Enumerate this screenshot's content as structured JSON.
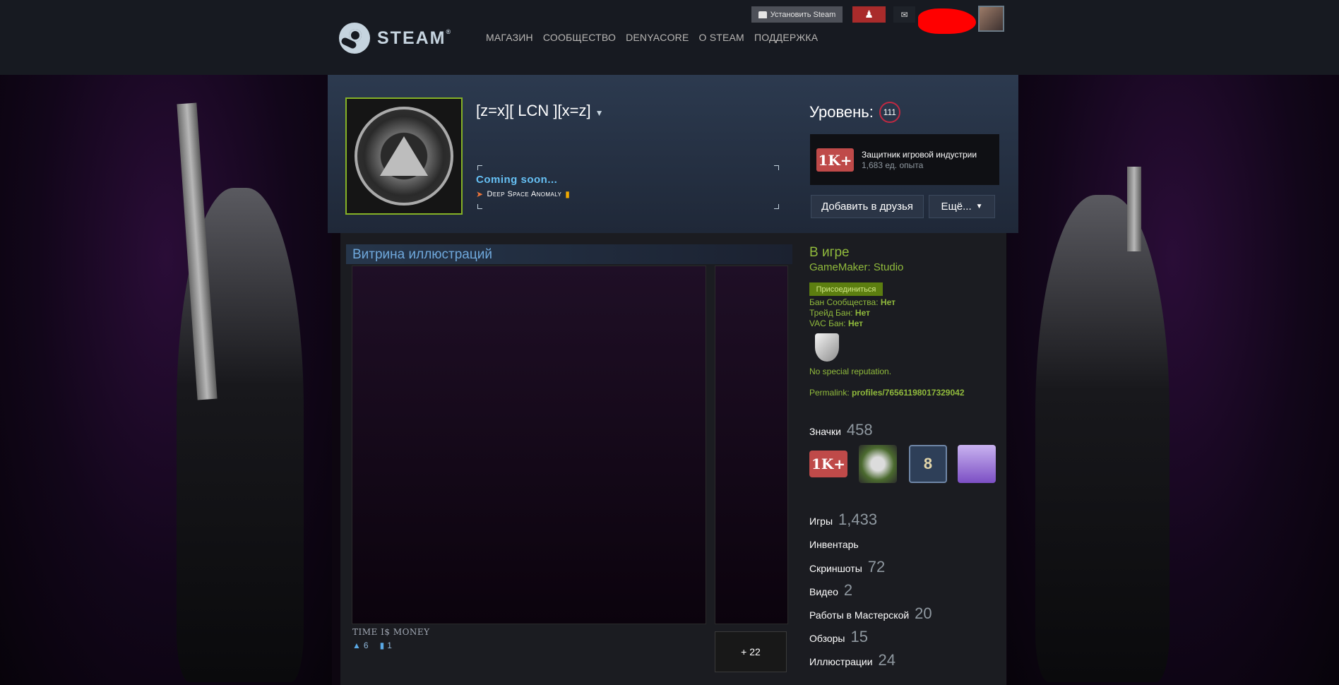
{
  "header": {
    "logo_text": "STEAM",
    "logo_mark": "®",
    "nav": [
      "МАГАЗИН",
      "СООБЩЕСТВО",
      "DENYACORE",
      "О STEAM",
      "ПОДДЕРЖКА"
    ],
    "install_label": "Установить Steam"
  },
  "profile": {
    "persona_name": "[z=x][ LCN ][x=z]",
    "summary_line1": "Coming soon...",
    "summary_line2": "Deep Space Anomaly",
    "level_label": "Уровень:",
    "level": "111",
    "featured_badge": {
      "name": "Защитник игровой индустрии",
      "xp": "1,683 ед. опыта",
      "icon_text": "1K+"
    },
    "add_friend_label": "Добавить в друзья",
    "more_label": "Ещё..."
  },
  "showcase": {
    "title": "Витрина иллюстраций",
    "art_title": "TIME I$ MONEY",
    "likes": "6",
    "comments": "1",
    "more_label": "+ 22"
  },
  "status": {
    "state": "В игре",
    "game": "GameMaker: Studio",
    "join_label": "Присоединиться",
    "bans": [
      {
        "label": "Бан Сообщества:",
        "value": "Нет"
      },
      {
        "label": "Трейд Бан:",
        "value": "Нет"
      },
      {
        "label": "VAC Бан:",
        "value": "Нет"
      }
    ],
    "reputation": "No special reputation.",
    "permalink_label": "Permalink:",
    "permalink_value": "profiles/76561198017329042"
  },
  "badges": {
    "label": "Значки",
    "count": "458",
    "items": [
      {
        "icon": "1k-plus-badge-icon",
        "text": "1K+"
      },
      {
        "icon": "world-badge-icon",
        "text": ""
      },
      {
        "icon": "eight-badge-icon",
        "text": "8"
      },
      {
        "icon": "gift-badge-icon",
        "text": ""
      }
    ]
  },
  "stats": [
    {
      "label": "Игры",
      "value": "1,433"
    },
    {
      "label": "Инвентарь",
      "value": ""
    },
    {
      "label": "Скриншоты",
      "value": "72"
    },
    {
      "label": "Видео",
      "value": "2"
    },
    {
      "label": "Работы в Мастерской",
      "value": "20"
    },
    {
      "label": "Обзоры",
      "value": "15"
    },
    {
      "label": "Иллюстрации",
      "value": "24"
    }
  ],
  "colors": {
    "header_bg": "#171a21",
    "accent_green": "#90ba3c",
    "accent_blue": "#66c0f4",
    "level_ring": "#c02942",
    "friends_red": "#a92b2b"
  }
}
